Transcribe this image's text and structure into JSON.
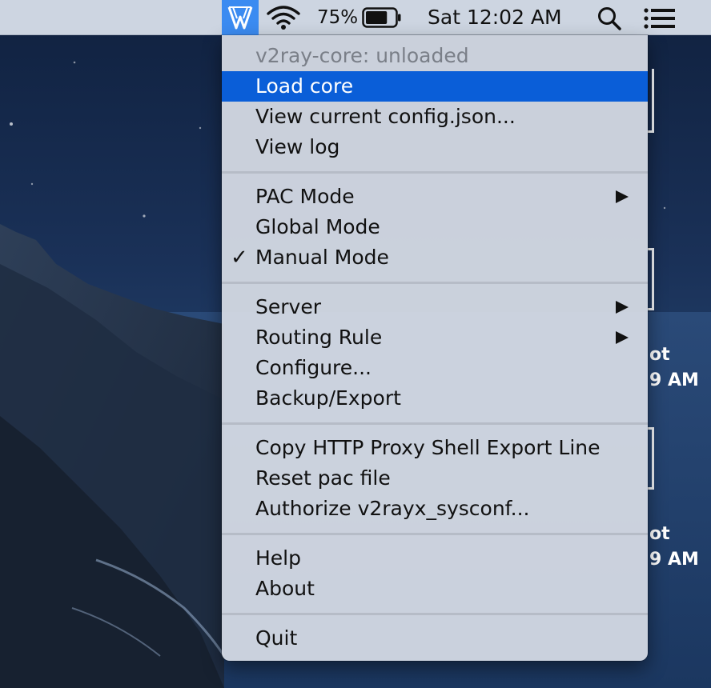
{
  "menubar": {
    "battery_percent": "75%",
    "battery_level": 0.75,
    "clock": "Sat 12:02 AM",
    "icons": [
      "v2rayx-app-icon",
      "wifi-icon",
      "battery-icon",
      "search-icon",
      "control-center-icon"
    ]
  },
  "menu": {
    "status": "v2ray-core: unloaded",
    "load_core": "Load core",
    "view_config": "View current config.json...",
    "view_log": "View log",
    "pac_mode": "PAC Mode",
    "global_mode": "Global Mode",
    "manual_mode": "Manual Mode",
    "check_mark": "✓",
    "server": "Server",
    "routing_rule": "Routing Rule",
    "configure": "Configure...",
    "backup_export": "Backup/Export",
    "copy_http_proxy": "Copy HTTP Proxy Shell Export Line",
    "reset_pac": "Reset pac file",
    "authorize_sysconf": "Authorize v2rayx_sysconf...",
    "help": "Help",
    "about": "About",
    "quit": "Quit"
  },
  "desktop": {
    "peek_1_line_1": "ot",
    "peek_1_line_2": "9 AM",
    "peek_2_line_1": "ot",
    "peek_2_line_2": "9 AM"
  },
  "colors": {
    "menubar_bg": "#cdd5e1",
    "app_icon_highlight": "#3b8bf1",
    "menu_bg": "#d6dbe4",
    "selection": "#0a5ed8",
    "disabled_text": "#7a7f88"
  }
}
